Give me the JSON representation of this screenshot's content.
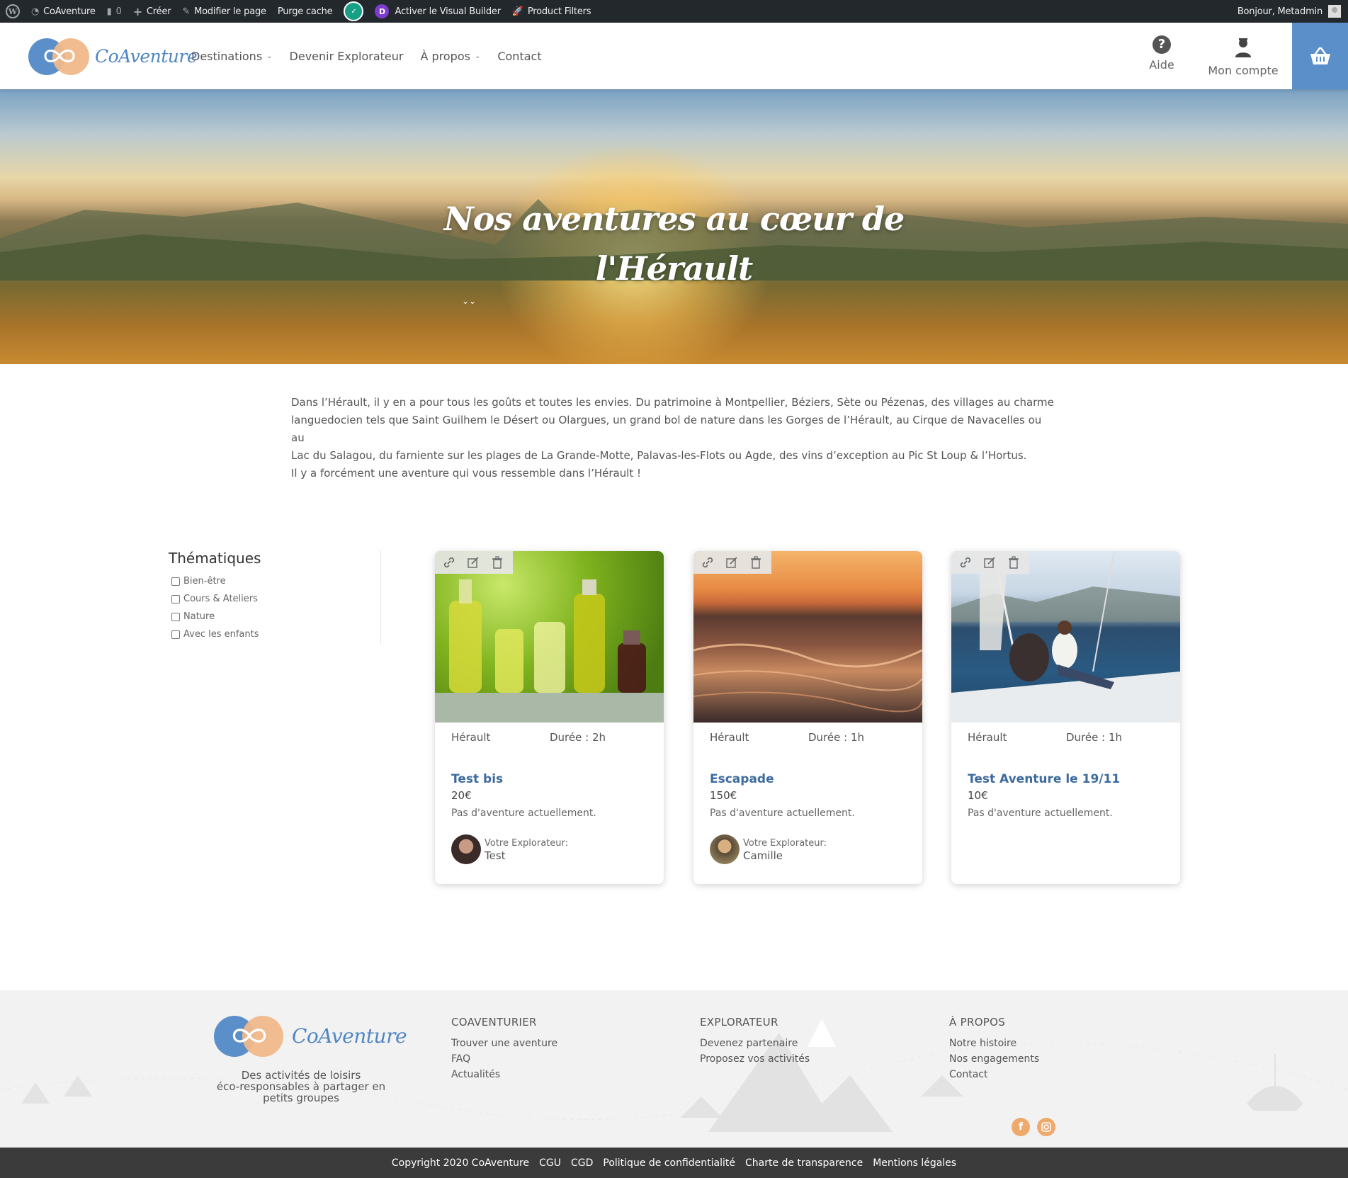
{
  "adminbar": {
    "site_name": "CoAventure",
    "comments_count": "0",
    "create_label": "Créer",
    "edit_page_label": "Modifier le page",
    "purge_cache_label": "Purge cache",
    "visual_builder_label": "Activer le Visual Builder",
    "product_filters_label": "Product Filters",
    "greeting": "Bonjour, Metadmin"
  },
  "header": {
    "logo_text": "CoAventure",
    "nav": [
      {
        "label": "Destinations",
        "has_dropdown": true
      },
      {
        "label": "Devenir Explorateur",
        "has_dropdown": false
      },
      {
        "label": "À propos",
        "has_dropdown": true
      },
      {
        "label": "Contact",
        "has_dropdown": false
      }
    ],
    "help_label": "Aide",
    "account_label": "Mon compte",
    "accent_color": "#5b8fc9"
  },
  "hero": {
    "title_line1": "Nos aventures au cœur de",
    "title_line2": "l'Hérault"
  },
  "intro": {
    "line1": "Dans l’Hérault, il y en a pour tous les goûts et toutes les envies. Du patrimoine à Montpellier, Béziers, Sète ou Pézenas, des villages au charme",
    "line2": "languedocien tels que Saint Guilhem le Désert ou Olargues, un grand bol de nature dans les Gorges de l’Hérault, au Cirque de Navacelles ou au",
    "line3": "Lac du Salagou, du farniente sur les plages de La Grande-Motte, Palavas-les-Flots ou Agde, des vins d’exception au Pic St Loup & l’Hortus.",
    "line4": "Il y a forcément une aventure qui vous ressemble dans l’Hérault !"
  },
  "filters": {
    "title": "Thématiques",
    "options": [
      "Bien-être",
      "Cours & Ateliers",
      "Nature",
      "Avec les enfants"
    ]
  },
  "cards": [
    {
      "location": "Hérault",
      "duration": "Durée : 2h",
      "title": "Test bis",
      "price": "20€",
      "availability": "Pas d'aventure actuellement.",
      "explorer_label": "Votre Explorateur:",
      "explorer_name": "Test"
    },
    {
      "location": "Hérault",
      "duration": "Durée : 1h",
      "title": "Escapade",
      "price": "150€",
      "availability": "Pas d'aventure actuellement.",
      "explorer_label": "Votre Explorateur:",
      "explorer_name": "Camille"
    },
    {
      "location": "Hérault",
      "duration": "Durée : 1h",
      "title": "Test Aventure le 19/11",
      "price": "10€",
      "availability": "Pas d'aventure actuellement."
    }
  ],
  "footer": {
    "logo_text": "CoAventure",
    "tagline_line1": "Des activités de loisirs",
    "tagline_line2": "éco-responsables à partager en",
    "tagline_line3": "petits groupes",
    "columns": [
      {
        "title": "COAVENTURIER",
        "links": [
          "Trouver une aventure",
          "FAQ",
          "Actualités"
        ]
      },
      {
        "title": "EXPLORATEUR",
        "links": [
          "Devenez partenaire",
          "Proposez vos activités"
        ]
      },
      {
        "title": "À PROPOS",
        "links": [
          "Notre histoire",
          "Nos engagements",
          "Contact"
        ]
      }
    ],
    "social": [
      "facebook-icon",
      "instagram-icon"
    ],
    "social_color": "#f0a96d"
  },
  "bottom_bar": [
    "Copyright 2020 CoAventure",
    "CGU",
    "CGD",
    "Politique de confidentialité",
    "Charte de transparence",
    "Mentions légales"
  ]
}
